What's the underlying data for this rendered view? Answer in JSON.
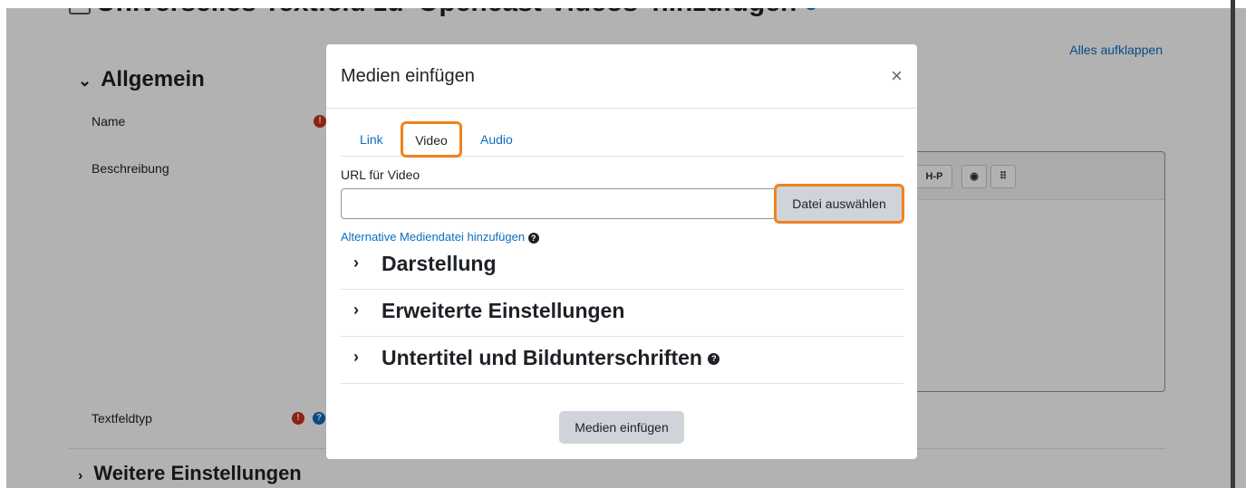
{
  "page": {
    "title": "Universelles Textfeld zu 'Opencast Videos' hinzufügen",
    "expand_all": "Alles aufklappen",
    "section_general": "Allgemein",
    "field_name": "Name",
    "field_description": "Beschreibung",
    "field_type": "Textfeldtyp",
    "more_settings": "Weitere Einstellungen",
    "toolbar": {
      "h5p": "H-P"
    }
  },
  "modal": {
    "title": "Medien einfügen",
    "close": "×",
    "tabs": [
      {
        "label": "Link"
      },
      {
        "label": "Video"
      },
      {
        "label": "Audio"
      }
    ],
    "url_label": "URL für Video",
    "url_value": "",
    "choose_file": "Datei auswählen",
    "alt_link": "Alternative Mediendatei hinzufügen",
    "sections": [
      {
        "label": "Darstellung"
      },
      {
        "label": "Erweiterte Einstellungen"
      },
      {
        "label": "Untertitel und Bildunterschriften"
      }
    ],
    "insert_button": "Medien einfügen"
  },
  "colors": {
    "link": "#0f6cbf",
    "highlight": "#f0821e",
    "required": "#ca3120"
  }
}
